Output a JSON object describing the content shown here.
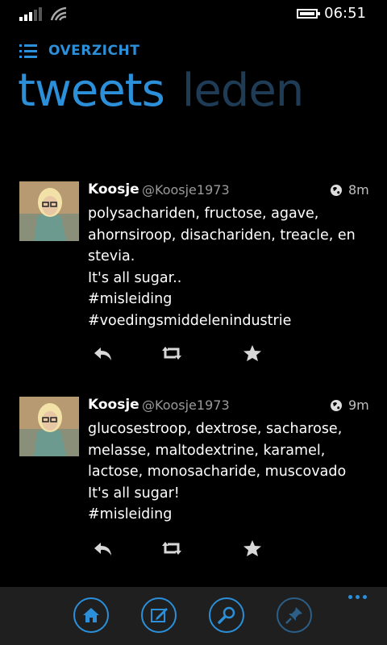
{
  "status": {
    "time": "06:51",
    "signal_icon": "signal-icon",
    "wifi_icon": "wifi-icon",
    "battery_icon": "battery-icon"
  },
  "header": {
    "section_label": "OVERZICHT",
    "section_icon": "list-icon",
    "pivots": [
      {
        "label": "tweets",
        "active": true
      },
      {
        "label": "leden",
        "active": false
      }
    ]
  },
  "tweets": [
    {
      "name": "Koosje",
      "handle": "@Koosje1973",
      "time": "8m",
      "lines": [
        "polysachariden, fructose, agave,",
        "ahornsiroop, disachariden, treacle, en",
        "stevia.",
        "It's all sugar..",
        "#misleiding",
        "#voedingsmiddelenindustrie"
      ]
    },
    {
      "name": "Koosje",
      "handle": "@Koosje1973",
      "time": "9m",
      "lines": [
        "glucosestroop, dextrose, sacharose,",
        "melasse, maltodextrine, karamel,",
        "lactose, monosacharide, muscovado",
        "It's all sugar!",
        "#misleiding"
      ]
    }
  ],
  "tweet_actions": [
    "reply-icon",
    "retweet-icon",
    "favorite-icon"
  ],
  "appbar": {
    "buttons": [
      "home-icon",
      "compose-icon",
      "search-icon",
      "pin-icon"
    ],
    "more_icon": "more-icon"
  },
  "colors": {
    "accent": "#2b8fd9",
    "inactive_pivot": "#1f3c57",
    "background": "#000000",
    "appbar": "#1f1f1f"
  }
}
